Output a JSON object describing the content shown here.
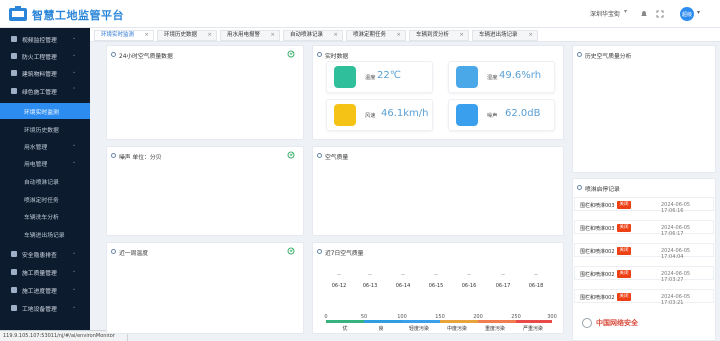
{
  "header": {
    "title": "智慧工地监管平台",
    "company": "深圳华宝街",
    "caret": "▾",
    "user_avatar_text": "超级"
  },
  "sidebar": {
    "items": [
      {
        "label": "视频监控管理",
        "caret": "⌄"
      },
      {
        "label": "防火工程管理",
        "caret": "⌄"
      },
      {
        "label": "建筑物料管理",
        "caret": "⌄"
      },
      {
        "label": "绿色施工管理",
        "caret": "⌃"
      },
      {
        "label": "环境实时监测"
      },
      {
        "label": "环境历史数据"
      },
      {
        "label": "用水管理",
        "caret": "⌄"
      },
      {
        "label": "用电管理",
        "caret": "⌄"
      },
      {
        "label": "自动喷淋记录"
      },
      {
        "label": "喷淋定时任务"
      },
      {
        "label": "车辆洗车分析"
      },
      {
        "label": "车辆进出场记录"
      },
      {
        "label": "安全隐患排查",
        "caret": "⌄"
      },
      {
        "label": "施工质量管理",
        "caret": "⌄"
      },
      {
        "label": "施工进度管理",
        "caret": "⌄"
      },
      {
        "label": "工地设备管理",
        "caret": "⌄"
      }
    ]
  },
  "status_url": "119.9.105.107:53011/nj/#/ai/environMonitor",
  "tabs": [
    {
      "label": "环境实时监测",
      "close": "×"
    },
    {
      "label": "环境历史数据",
      "close": "×"
    },
    {
      "label": "用水用电报警",
      "close": "×"
    },
    {
      "label": "自动喷淋记录",
      "close": "×"
    },
    {
      "label": "喷淋定期任务",
      "close": "×"
    },
    {
      "label": "车辆到货分析",
      "close": "×"
    },
    {
      "label": "车辆进出场记录",
      "close": "×"
    }
  ],
  "cards": {
    "hour24": "24小时空气质量数据",
    "realtime": "实时数据",
    "history": "历史空气质量分析",
    "noise": "噪声  单位：分贝",
    "airquality": "空气质量",
    "alarm": "喷淋启停记录",
    "temp_today": "近一周温度",
    "week7": "近7日空气质量"
  },
  "realtime": [
    {
      "label": "温度",
      "value": "22℃",
      "color": "#2fbf9a",
      "icon": "thermometer-icon"
    },
    {
      "label": "湿度",
      "value": "49.6%rh",
      "color": "#4aa8e8",
      "icon": "humidity-icon"
    },
    {
      "label": "风速",
      "value": "46.1km/h",
      "color": "#f5c316",
      "icon": "wind-icon"
    },
    {
      "label": "噪声",
      "value": "62.0dB",
      "color": "#3aa0ee",
      "icon": "speaker-icon"
    }
  ],
  "alarms": [
    {
      "name": "围栏和喷淋003",
      "badge": "关闭",
      "time": "2024-06-05 17:06:16"
    },
    {
      "name": "围栏和喷淋003",
      "badge": "关闭",
      "time": "2024-06-05 17:06:17"
    },
    {
      "name": "围栏和喷淋002",
      "badge": "关闭",
      "time": "2024-06-05 17:04:04"
    },
    {
      "name": "围栏和喷淋002",
      "badge": "关闭",
      "time": "2024-06-05 17:03:27"
    },
    {
      "name": "围栏和喷淋002",
      "badge": "关闭",
      "time": "2024-06-05 17:03:21"
    }
  ],
  "forecast": {
    "top": [
      "--",
      "--",
      "--",
      "--",
      "--",
      "--",
      "--"
    ],
    "dates": [
      "06-12",
      "06-13",
      "06-14",
      "06-15",
      "06-16",
      "06-17",
      "06-18"
    ]
  },
  "aqi_scale": {
    "ticks": [
      "0",
      "50",
      "100",
      "150",
      "200",
      "250",
      "300"
    ],
    "labels": [
      "优",
      "良",
      "轻度污染",
      "中度污染",
      "重度污染",
      "严重污染"
    ],
    "colors": [
      "#36b37e",
      "#2f9de0",
      "#3aa0ee",
      "#e8a33a",
      "#f07c4f",
      "#e84a4a"
    ]
  },
  "watermark": "中国网络安全"
}
